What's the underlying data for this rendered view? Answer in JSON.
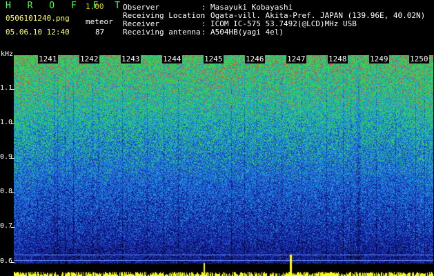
{
  "header": {
    "app_title": "H R O F F T",
    "app_version": "1.00",
    "file_name": "0506101240.png",
    "datetime": "05.06.10 12:40",
    "count_label": "meteor",
    "count_value": "87",
    "info": [
      {
        "label": "Observer",
        "value": "Masayuki Kobayashi"
      },
      {
        "label": "Receiving Location",
        "value": "Ogata-vill. Akita-Pref. JAPAN (139.96E, 40.02N)"
      },
      {
        "label": "Receiver",
        "value": "ICOM IC-575 53.7492(@LCD)MHz USB"
      },
      {
        "label": "Receiving antenna",
        "value": "A504HB(yagi 4el)"
      }
    ],
    "separator": ":"
  },
  "spectrogram": {
    "y_unit": "kHz",
    "y_ticks": [
      "1.1",
      "1.0",
      "0.9",
      "0.8",
      "0.7",
      "0.6"
    ],
    "time_labels": [
      "1241",
      "1242",
      "1243",
      "1244",
      "1245",
      "1246",
      "1247",
      "1248",
      "1249",
      "1250"
    ],
    "colors": {
      "high": "#ff3c3c",
      "mid_high": "#34d35b",
      "mid": "#1a8fe0",
      "low": "#1f3fc0",
      "base": "#0a0f78",
      "meteor_bar": "#ffff00",
      "reference_line": "#6a8cff"
    }
  }
}
